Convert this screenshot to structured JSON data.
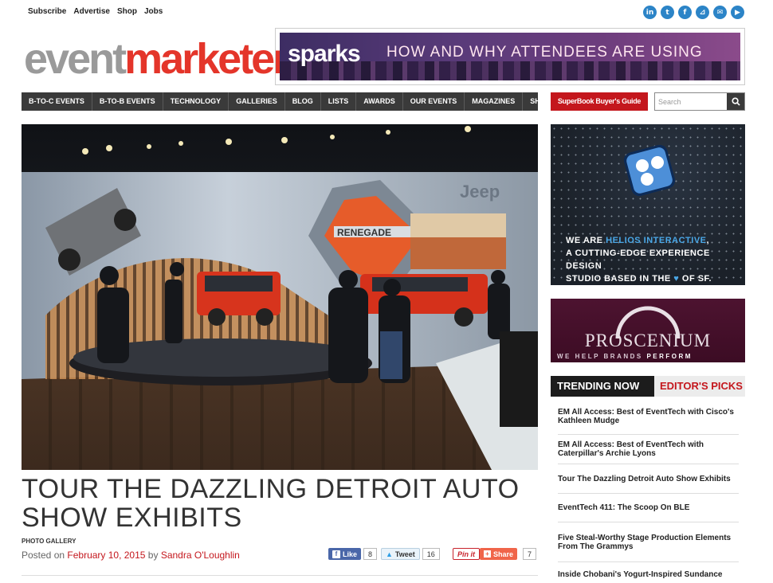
{
  "header": {
    "util_links": [
      "Subscribe",
      "Advertise",
      "Shop",
      "Jobs"
    ],
    "social_icons": [
      {
        "name": "linkedin-icon",
        "glyph": "in"
      },
      {
        "name": "twitter-icon",
        "glyph": "t"
      },
      {
        "name": "facebook-icon",
        "glyph": "f"
      },
      {
        "name": "rss-icon",
        "glyph": "⊿"
      },
      {
        "name": "email-icon",
        "glyph": "✉"
      },
      {
        "name": "youtube-icon",
        "glyph": "▶"
      }
    ],
    "logo_part1": "event",
    "logo_part2": "marketer",
    "logo_reg": "®"
  },
  "banner": {
    "brand": "sparks",
    "text": "HOW AND WHY ATTENDEES ARE USING"
  },
  "nav": {
    "items": [
      "B-TO-C EVENTS",
      "B-TO-B EVENTS",
      "TECHNOLOGY",
      "GALLERIES",
      "BLOG",
      "LISTS",
      "AWARDS",
      "OUR EVENTS",
      "MAGAZINES",
      "SHOP"
    ],
    "superbook": "SuperBook Buyer's Guide",
    "search_placeholder": "Search"
  },
  "hero": {
    "brand_word": "Jeep",
    "sign_word": "RENEGADE"
  },
  "article": {
    "title": "TOUR THE DAZZLING DETROIT AUTO SHOW EXHIBITS",
    "category": "PHOTO GALLERY",
    "posted_prefix": "Posted on",
    "date": "February 10, 2015",
    "by": "by",
    "author": "Sandra O'Loughlin"
  },
  "share": {
    "like_label": "Like",
    "like_count": "8",
    "tweet_label": "Tweet",
    "tweet_count": "16",
    "pin_label": "Pin it",
    "share_label": "Share",
    "share_count": "7"
  },
  "sidebar": {
    "helios": {
      "line1_prefix": "WE ARE ",
      "line1_highlight": "HELIOS INTERACTIVE",
      "line1_suffix": ",",
      "line2": "A CUTTING-EDGE EXPERIENCE DESIGN",
      "line3_prefix": "STUDIO BASED IN THE ",
      "line3_suffix": " OF SF."
    },
    "proscenium": {
      "name": "PROSCENIUM",
      "tag_prefix": "WE HELP BRANDS ",
      "tag_bold": "PERFORM"
    },
    "tabs": {
      "trending": "TRENDING NOW",
      "editors": "EDITOR'S PICKS"
    },
    "trending": [
      "EM All Access: Best of EventTech with Cisco's Kathleen Mudge",
      "EM All Access: Best of EventTech with Caterpillar's Archie Lyons",
      "Tour The Dazzling Detroit Auto Show Exhibits",
      "EventTech 411: The Scoop On BLE",
      "Five Steal-Worthy Stage Production Elements From The Grammys",
      "Inside Chobani's Yogurt-Inspired Sundance"
    ]
  },
  "colors": {
    "brand_red": "#c4171d",
    "nav_dark": "#3a3a3a",
    "social_blue": "#2c84c7"
  }
}
